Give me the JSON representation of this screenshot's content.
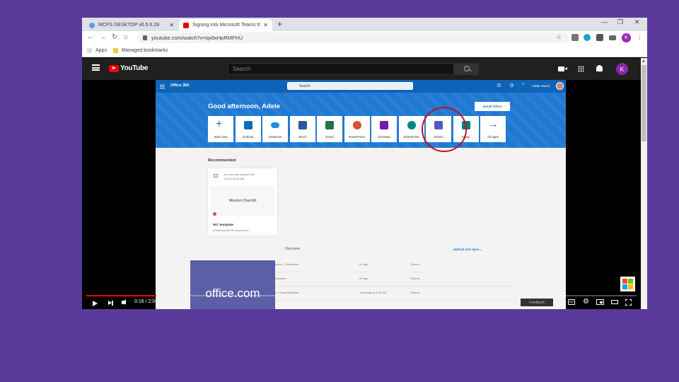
{
  "browser": {
    "tabs": [
      {
        "title": "MCPS DESKTOP v6.5.6.28",
        "icon": "globe-icon"
      },
      {
        "title": "Signing into Microsoft Teams for",
        "icon": "youtube-icon"
      }
    ],
    "url": "youtube.com/watch?v=qx8xHpRMFHU",
    "profile_initial": "K",
    "bookmarks": [
      "Apps",
      "Managed bookmarks"
    ]
  },
  "youtube": {
    "logo_text": "YouTube",
    "search_placeholder": "Search",
    "avatar_initial": "K"
  },
  "office365": {
    "brand": "Office 365",
    "search_placeholder": "Search",
    "user_name": "Adele Vance",
    "greeting": "Good afternoon, Adele",
    "install_label": "Install Office",
    "apps": [
      {
        "label": "Start new",
        "color": "#1f78d1"
      },
      {
        "label": "Outlook",
        "color": "#0f6cbd"
      },
      {
        "label": "OneDrive",
        "color": "#1e8fe0"
      },
      {
        "label": "Word",
        "color": "#2b579a"
      },
      {
        "label": "Excel",
        "color": "#217346"
      },
      {
        "label": "PowerPoint",
        "color": "#d35230"
      },
      {
        "label": "OneNote",
        "color": "#7719aa"
      },
      {
        "label": "SharePoint",
        "color": "#038387"
      },
      {
        "label": "Teams",
        "color": "#5059c9"
      },
      {
        "label": "Sway",
        "color": "#008272"
      },
      {
        "label": "All apps",
        "color": "#1f78d1"
      }
    ],
    "recommended_title": "Recommended",
    "card": {
      "meta_line1": "You recently opened this",
      "meta_line2": "Thu at 10:44 AM",
      "preview": "Winston Churchill",
      "name": "WC template",
      "url": "m365edu245790.sharepoint..."
    },
    "discover_tab": "Discover",
    "upload_label": "Upload and open...",
    "files": [
      {
        "name": "ualScience › SiteAssets",
        "time": "6h ago",
        "status": "Shared"
      },
      {
        "name": "s › SiteAssets",
        "time": "6h ago",
        "status": "Shared"
      },
      {
        "name": "ivision › Class Materials",
        "time": "Yesterday at 4:42 AM",
        "status": "Shared"
      }
    ],
    "overlay_text": "office.com"
  },
  "player": {
    "time": "0:16 / 2:06",
    "progress_fraction": 0.127,
    "feedback_label": "Feedback",
    "cc_label": "CC"
  }
}
